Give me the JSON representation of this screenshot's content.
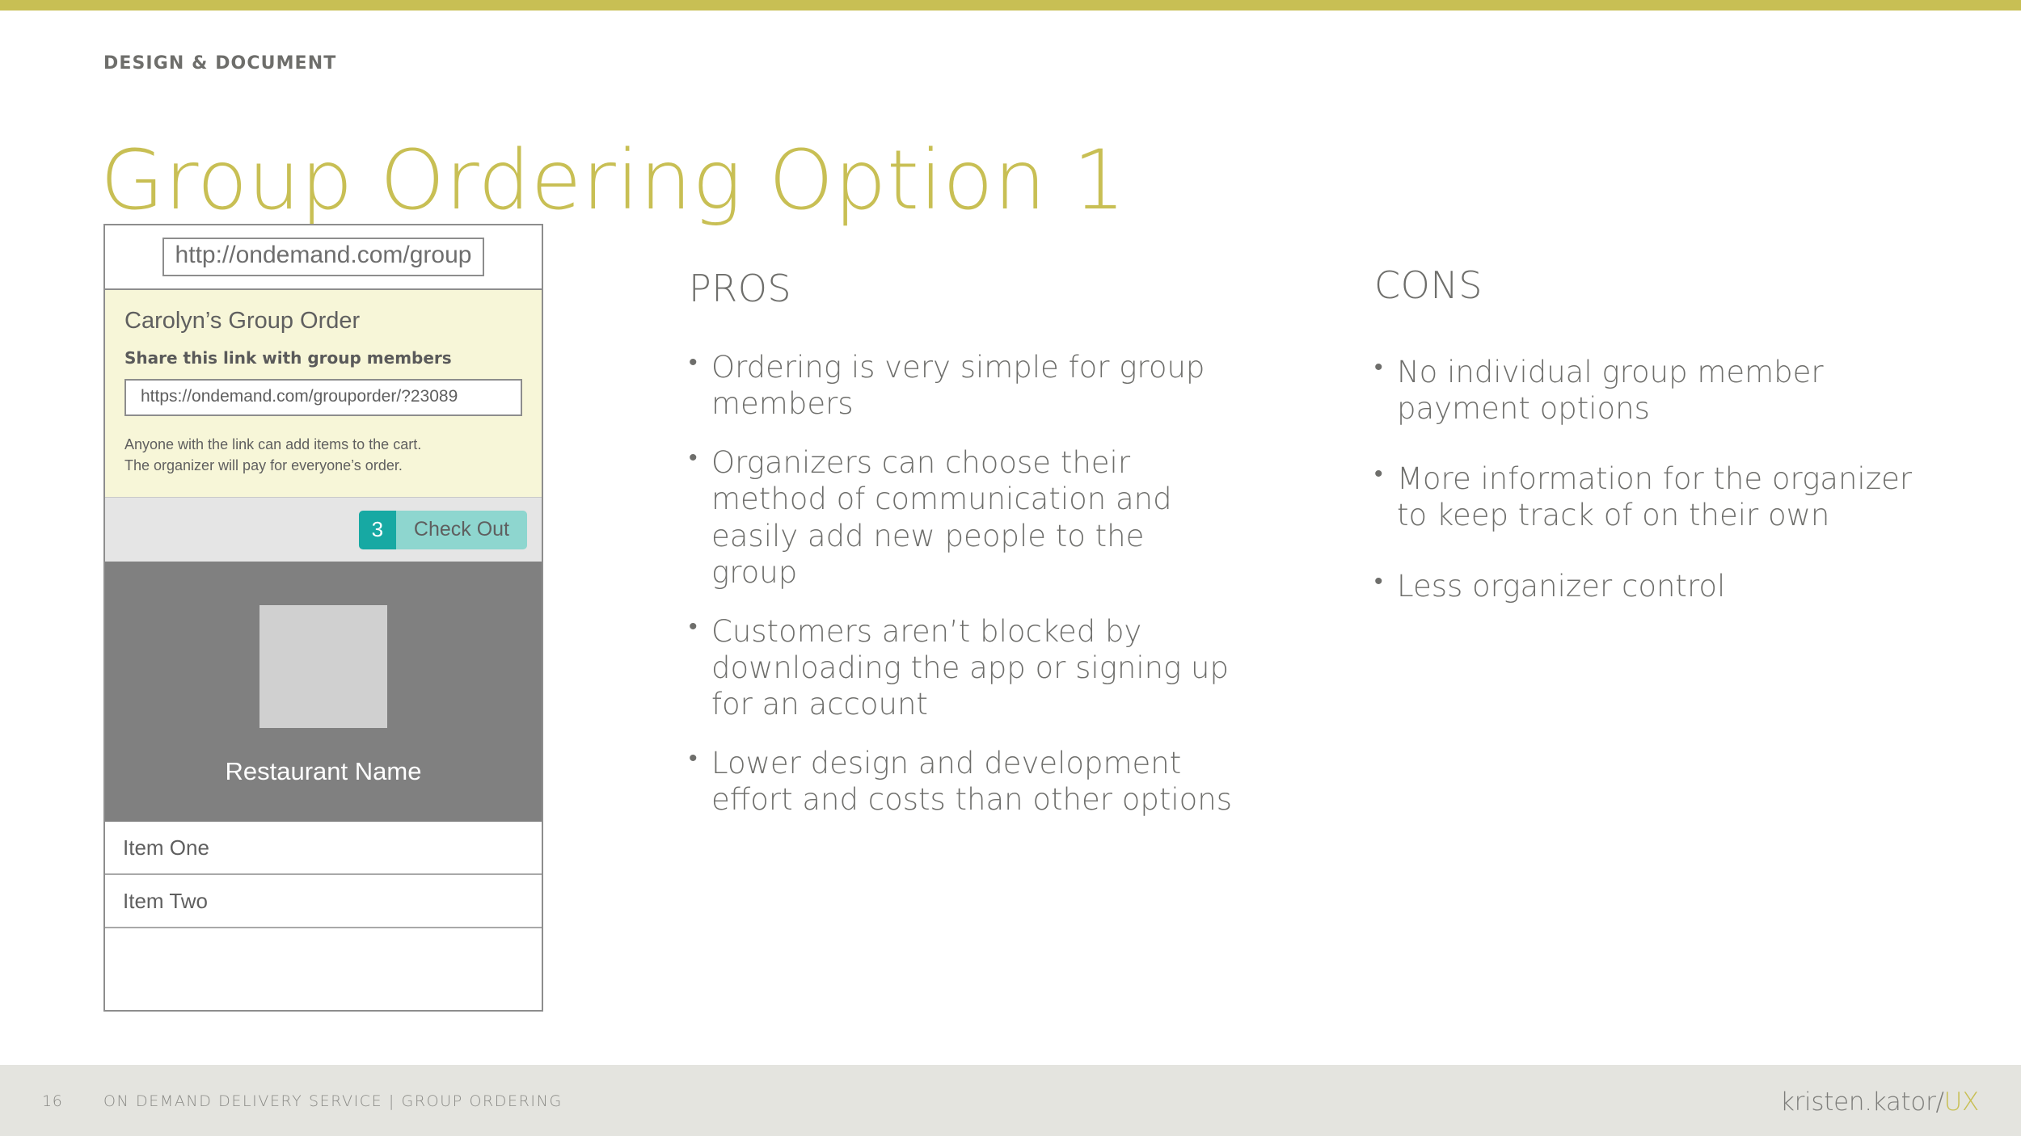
{
  "theme": {
    "accent": "#c8bf54",
    "text_gray": "#6e6e6b",
    "footer_bg": "#e4e4df",
    "mock_yellow": "#f7f6d8",
    "teal_dark": "#17a9a3",
    "teal_light": "#8ed6cf",
    "hero_gray": "#808080"
  },
  "header": {
    "kicker": "DESIGN & DOCUMENT",
    "title": "Group Ordering Option 1"
  },
  "mockup": {
    "browser_url": "http://ondemand.com/group",
    "order_title": "Carolyn’s Group Order",
    "share_label": "Share this link with group members",
    "share_link": "https://ondemand.com/grouporder/?23089",
    "helper_line_1": "Anyone with the link can add items to the cart.",
    "helper_line_2": "The organizer will pay for everyone’s order.",
    "cart_count": "3",
    "checkout_label": "Check Out",
    "restaurant_name": "Restaurant Name",
    "items": [
      "Item One",
      "Item Two"
    ]
  },
  "pros": {
    "heading": "PROS",
    "items": [
      "Ordering is very simple for group members",
      "Organizers can choose their method of communication and easily add new people to the group",
      "Customers aren’t blocked by downloading the app or signing up for an account",
      "Lower design and development effort and costs than other options"
    ]
  },
  "cons": {
    "heading": "CONS",
    "items": [
      "No individual group member payment options",
      "More information for the organizer to keep track of on their own",
      "Less organizer control"
    ]
  },
  "footer": {
    "page_number": "16",
    "breadcrumb": "ON DEMAND DELIVERY SERVICE | GROUP ORDERING",
    "logo_main": "kristen.kator/",
    "logo_accent": "UX"
  }
}
